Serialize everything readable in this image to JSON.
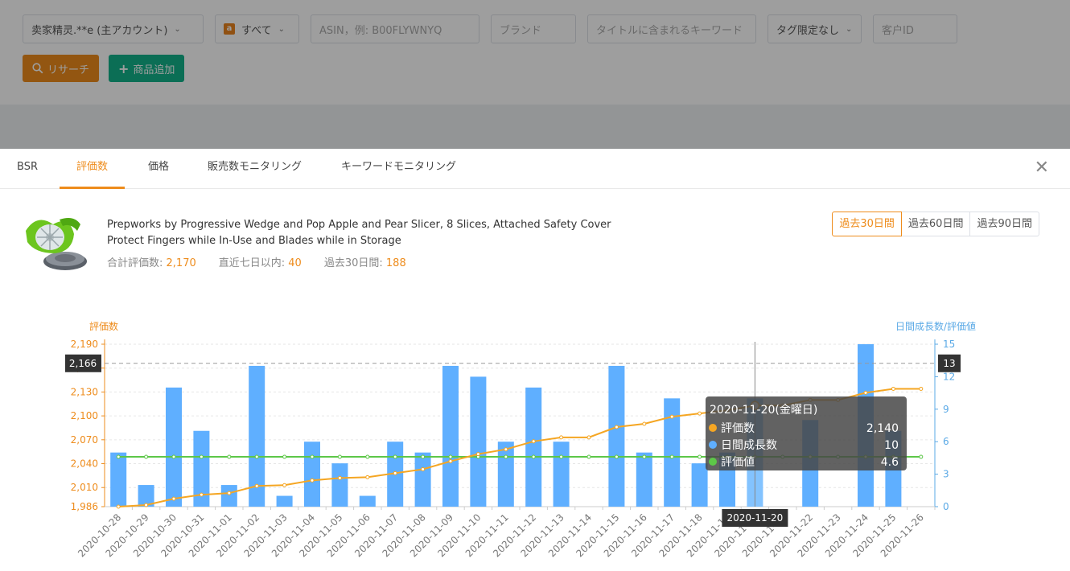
{
  "filters": {
    "account": "卖家精灵.**e (主アカウント)",
    "marketplace": "すべて",
    "asin_placeholder": "ASIN，例: B00FLYWNYQ",
    "brand_placeholder": "ブランド",
    "keyword_placeholder": "タイトルに含まれるキーワード",
    "tag": "タグ限定なし",
    "customer_placeholder": "客户ID"
  },
  "buttons": {
    "research": "リサーチ",
    "add_product": "商品追加"
  },
  "tabs": [
    {
      "label": "BSR"
    },
    {
      "label": "評価数"
    },
    {
      "label": "価格"
    },
    {
      "label": "販売数モニタリング"
    },
    {
      "label": "キーワードモニタリング"
    }
  ],
  "product": {
    "title_line1": "Prepworks by Progressive Wedge and Pop Apple and Pear Slicer, 8 Slices, Attached Safety Cover",
    "title_line2": "Protect Fingers while In-Use and Blades while in Storage",
    "total_reviews_label": "合計評価数:",
    "total_reviews": "2,170",
    "last7_label": "直近七日以内:",
    "last7": "40",
    "last30_label": "過去30日間:",
    "last30": "188"
  },
  "ranges": [
    "過去30日間",
    "過去60日間",
    "過去90日間"
  ],
  "colors": {
    "accent": "#ee8c1c",
    "bar": "#5fafff",
    "line_reviews": "#f5a623",
    "line_rating": "#5dc748"
  },
  "chart_data": {
    "type": "bar",
    "left_axis_label": "評価数",
    "right_axis_label": "日間成長数/評価値",
    "left_ticks": [
      "1,986",
      "2,010",
      "2,040",
      "2,070",
      "2,100",
      "2,130",
      "2,160",
      "2,190"
    ],
    "left_tick_values": [
      1986,
      2010,
      2040,
      2070,
      2100,
      2130,
      2160,
      2190
    ],
    "left_range": [
      1986,
      2190
    ],
    "right_ticks": [
      "0",
      "3",
      "6",
      "9",
      "12",
      "15"
    ],
    "right_range": [
      0,
      15
    ],
    "categories": [
      "2020-10-28",
      "2020-10-29",
      "2020-10-30",
      "2020-10-31",
      "2020-11-01",
      "2020-11-02",
      "2020-11-03",
      "2020-11-04",
      "2020-11-05",
      "2020-11-06",
      "2020-11-07",
      "2020-11-08",
      "2020-11-09",
      "2020-11-10",
      "2020-11-11",
      "2020-11-12",
      "2020-11-13",
      "2020-11-14",
      "2020-11-15",
      "2020-11-16",
      "2020-11-17",
      "2020-11-18",
      "2020-11-19",
      "2020-11-20",
      "2020-11-21",
      "2020-11-22",
      "2020-11-23",
      "2020-11-24",
      "2020-11-25",
      "2020-11-26"
    ],
    "series": [
      {
        "name": "評価数",
        "axis": "left",
        "values": [
          1986,
          1988,
          1996,
          2001,
          2003,
          2012,
          2013,
          2019,
          2022,
          2023,
          2028,
          2033,
          2043,
          2052,
          2058,
          2068,
          2073,
          2073,
          2086,
          2090,
          2099,
          2103,
          2107,
          2113,
          2113,
          2120,
          2120,
          2129,
          2134,
          2134
        ]
      },
      {
        "name": "日間成長数",
        "axis": "right",
        "values": [
          5,
          2,
          11,
          7,
          2,
          13,
          1,
          6,
          4,
          1,
          6,
          5,
          13,
          12,
          6,
          11,
          6,
          0,
          13,
          5,
          10,
          4,
          5,
          10,
          0,
          8,
          0,
          15,
          7,
          0
        ]
      },
      {
        "name": "評価値",
        "axis": "right",
        "values": [
          4.6,
          4.6,
          4.6,
          4.6,
          4.6,
          4.6,
          4.6,
          4.6,
          4.6,
          4.6,
          4.6,
          4.6,
          4.6,
          4.6,
          4.6,
          4.6,
          4.6,
          4.6,
          4.6,
          4.6,
          4.6,
          4.6,
          4.6,
          4.6,
          4.6,
          4.6,
          4.6,
          4.6,
          4.6,
          4.6
        ]
      }
    ],
    "hover_index": 23,
    "crosshair_left_value": "2,166",
    "crosshair_left_num": 2166,
    "crosshair_right_value": "13",
    "tooltip": {
      "title": "2020-11-20(金曜日)",
      "rows": [
        {
          "label": "評価数",
          "value": "2,140",
          "color": "#f5a623"
        },
        {
          "label": "日間成長数",
          "value": "10",
          "color": "#5fafff"
        },
        {
          "label": "評価値",
          "value": "4.6",
          "color": "#5dc748"
        }
      ]
    },
    "x_pointer_label": "2020-11-20"
  }
}
